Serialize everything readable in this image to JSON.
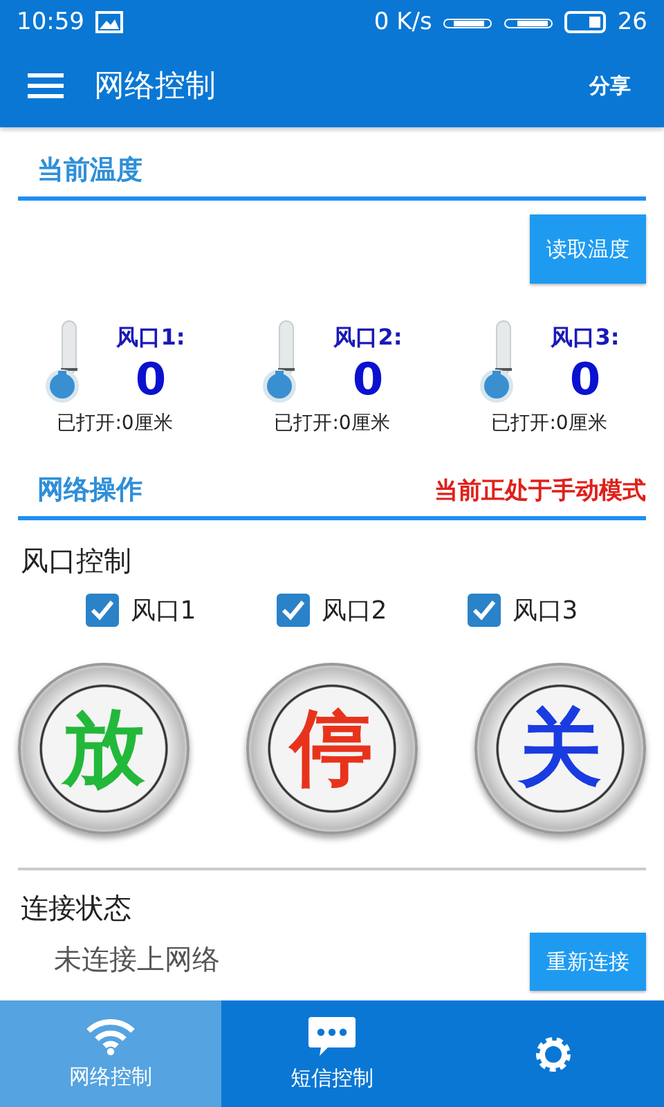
{
  "status_bar": {
    "time": "10:59",
    "speed": "0 K/s",
    "battery": "26"
  },
  "app_bar": {
    "title": "网络控制",
    "action": "分享"
  },
  "temperature": {
    "title": "当前温度",
    "read_button": "读取温度",
    "vents": [
      {
        "label": "风口1:",
        "value": "0",
        "opened": "已打开:0厘米"
      },
      {
        "label": "风口2:",
        "value": "0",
        "opened": "已打开:0厘米"
      },
      {
        "label": "风口3:",
        "value": "0",
        "opened": "已打开:0厘米"
      }
    ]
  },
  "operation": {
    "title": "网络操作",
    "mode": "当前正处于手动模式"
  },
  "vent_control": {
    "title": "风口控制",
    "checkboxes": [
      {
        "label": "风口1",
        "checked": true
      },
      {
        "label": "风口2",
        "checked": true
      },
      {
        "label": "风口3",
        "checked": true
      }
    ],
    "buttons": [
      {
        "label": "放",
        "color": "#22b83a"
      },
      {
        "label": "停",
        "color": "#e8331c"
      },
      {
        "label": "关",
        "color": "#1a3be0"
      }
    ]
  },
  "connection": {
    "title": "连接状态",
    "status": "未连接上网络",
    "reconnect": "重新连接"
  },
  "bottom_nav": [
    {
      "kind": "wifi",
      "label": "网络控制",
      "selected": true
    },
    {
      "kind": "message",
      "label": "短信控制",
      "selected": false
    },
    {
      "kind": "gear",
      "selected": false
    }
  ]
}
